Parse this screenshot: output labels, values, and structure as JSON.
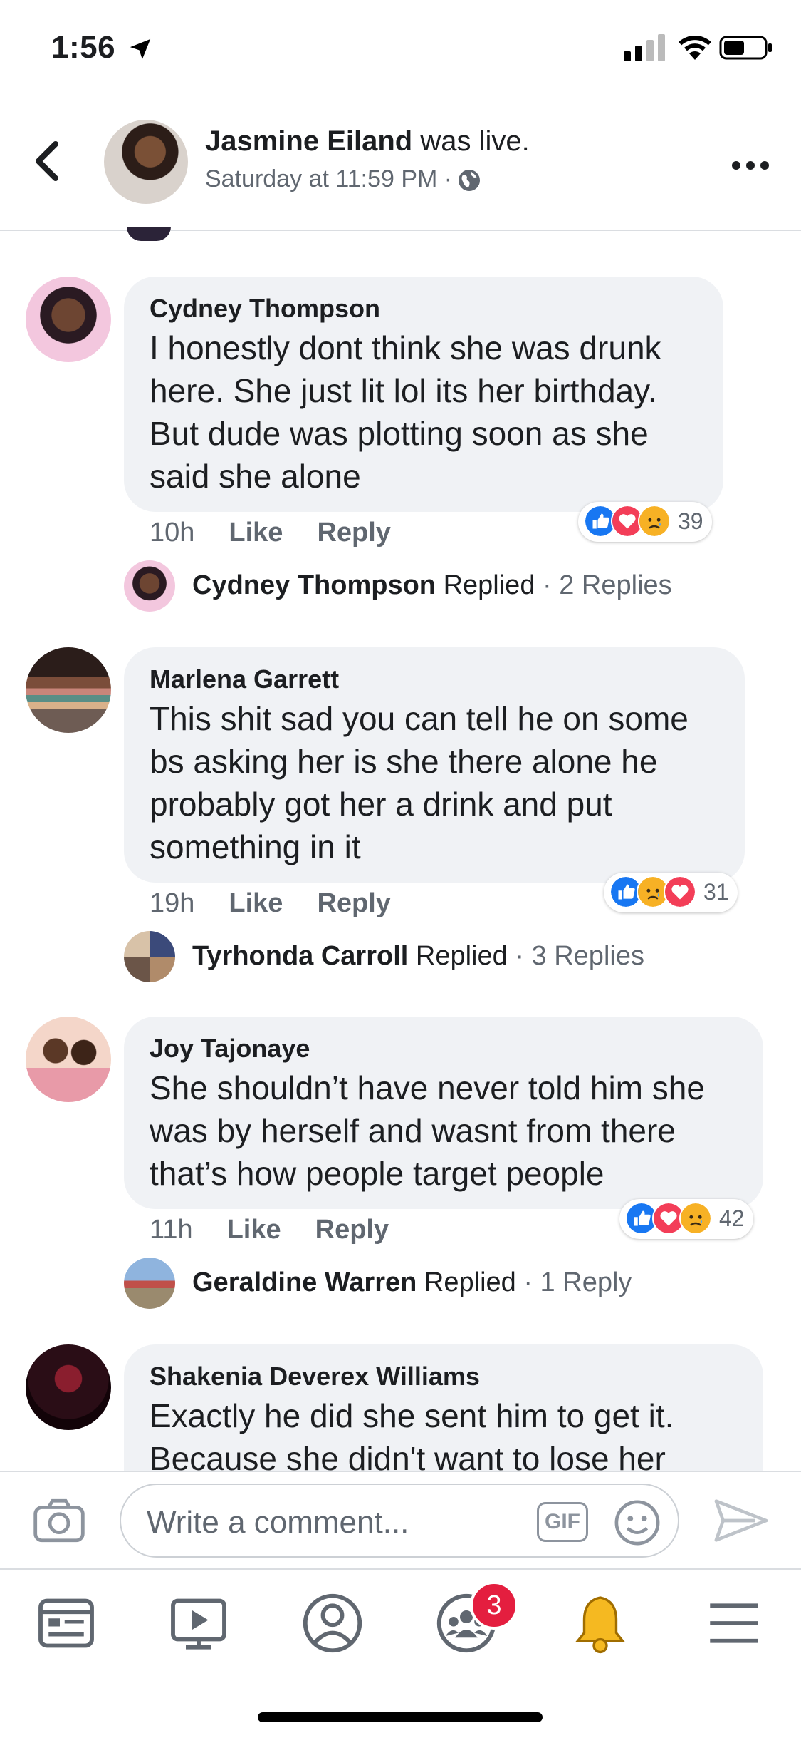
{
  "status_bar": {
    "time": "1:56"
  },
  "header": {
    "name": "Jasmine Eiland",
    "name_suffix": " was live.",
    "subtitle": "Saturday at 11:59 PM ·",
    "icons": [
      "back-chevron-icon",
      "globe-icon",
      "more-dots-icon"
    ]
  },
  "comments": [
    {
      "author": "Cydney Thompson",
      "text": "I honestly dont think she was drunk\nhere. She just lit lol its her birthday.\nBut dude was plotting soon as she\nsaid she alone",
      "time": "10h",
      "like_label": "Like",
      "reply_label": "Reply",
      "reaction_count": "39",
      "reactions": [
        "like",
        "love",
        "sad"
      ],
      "reply_summary": {
        "name": "Cydney Thompson",
        "action": " Replied",
        "count": "· 2 Replies"
      }
    },
    {
      "author": "Marlena Garrett",
      "text": "This shit sad you can tell he on some\nbs asking her is she there alone he\nprobably got her a drink and put\nsomething in it",
      "time": "19h",
      "like_label": "Like",
      "reply_label": "Reply",
      "reaction_count": "31",
      "reactions": [
        "like",
        "sad",
        "love"
      ],
      "reply_summary": {
        "name": "Tyrhonda Carroll",
        "action": " Replied",
        "count": "· 3 Replies"
      }
    },
    {
      "author": "Joy Tajonaye",
      "text": "She shouldn’t have never told him she\nwas by herself and wasnt from there\nthat’s how people target people",
      "time": "11h",
      "like_label": "Like",
      "reply_label": "Reply",
      "reaction_count": "42",
      "reactions": [
        "like",
        "love",
        "sad"
      ],
      "reply_summary": {
        "name": "Geraldine Warren",
        "action": " Replied",
        "count": "· 1 Reply"
      }
    },
    {
      "author": "Shakenia Deverex Williams",
      "text": "Exactly he did she sent him to get it.\nBecause she didn't want to lose her"
    }
  ],
  "composer": {
    "placeholder": "Write a comment...",
    "gif_label": "GIF"
  },
  "tab_bar": {
    "items": [
      "news-feed-icon",
      "watch-icon",
      "profile-icon",
      "groups-icon",
      "notifications-bell-icon",
      "menu-icon"
    ],
    "groups_badge": "3"
  },
  "colors": {
    "like_blue": "#1877f2",
    "love_red": "#f33e58",
    "sad_yellow": "#f7b125",
    "bubble_gray": "#f0f2f5",
    "badge_red": "#e41e3f",
    "bell_yellow": "#f5b921"
  }
}
